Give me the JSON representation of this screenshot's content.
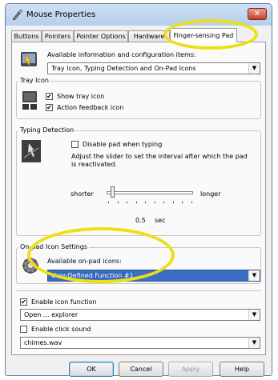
{
  "window": {
    "title": "Mouse Properties",
    "close_label": "✕"
  },
  "tabs": [
    {
      "label": "Buttons",
      "active": false
    },
    {
      "label": "Pointers",
      "active": false
    },
    {
      "label": "Pointer Options",
      "active": false
    },
    {
      "label": "Hardware",
      "active": false
    },
    {
      "label": "Finger-sensing Pad",
      "active": true
    }
  ],
  "info": {
    "text": "Available information and configuration items:",
    "combo_value": "Tray Icon, Typing Detection and On-Pad Icons"
  },
  "tray_icon": {
    "group_label": "Tray Icon",
    "show_tray_icon": {
      "label": "Show tray icon",
      "checked": true
    },
    "action_feedback": {
      "label": "Action feedback icon",
      "checked": true
    }
  },
  "typing_detection": {
    "group_label": "Typing Detection",
    "disable_pad": {
      "label": "Disable pad when typing",
      "checked": false
    },
    "description": "Adjust the slider to set the interval after which the pad is reactivated.",
    "slider_min_label": "shorter",
    "slider_max_label": "longer",
    "slider_value": "0.5",
    "slider_unit": "sec",
    "slider_position": 0.05
  },
  "onpad": {
    "group_label": "On-pad Icon Settings",
    "available_label": "Available on-pad icons:",
    "selected_icon": "User-Defined Function #1",
    "enable_icon_function": {
      "label": "Enable icon function",
      "checked": true
    },
    "function_value": "Open ... explorer",
    "enable_click_sound": {
      "label": "Enable click sound",
      "checked": false
    },
    "sound_value": "chimes.wav"
  },
  "buttons": {
    "ok": "OK",
    "cancel": "Cancel",
    "apply": "Apply",
    "help": "Help"
  },
  "colors": {
    "highlight": "#ecdf14",
    "selection": "#3a6fc4",
    "close": "#c6402a"
  }
}
